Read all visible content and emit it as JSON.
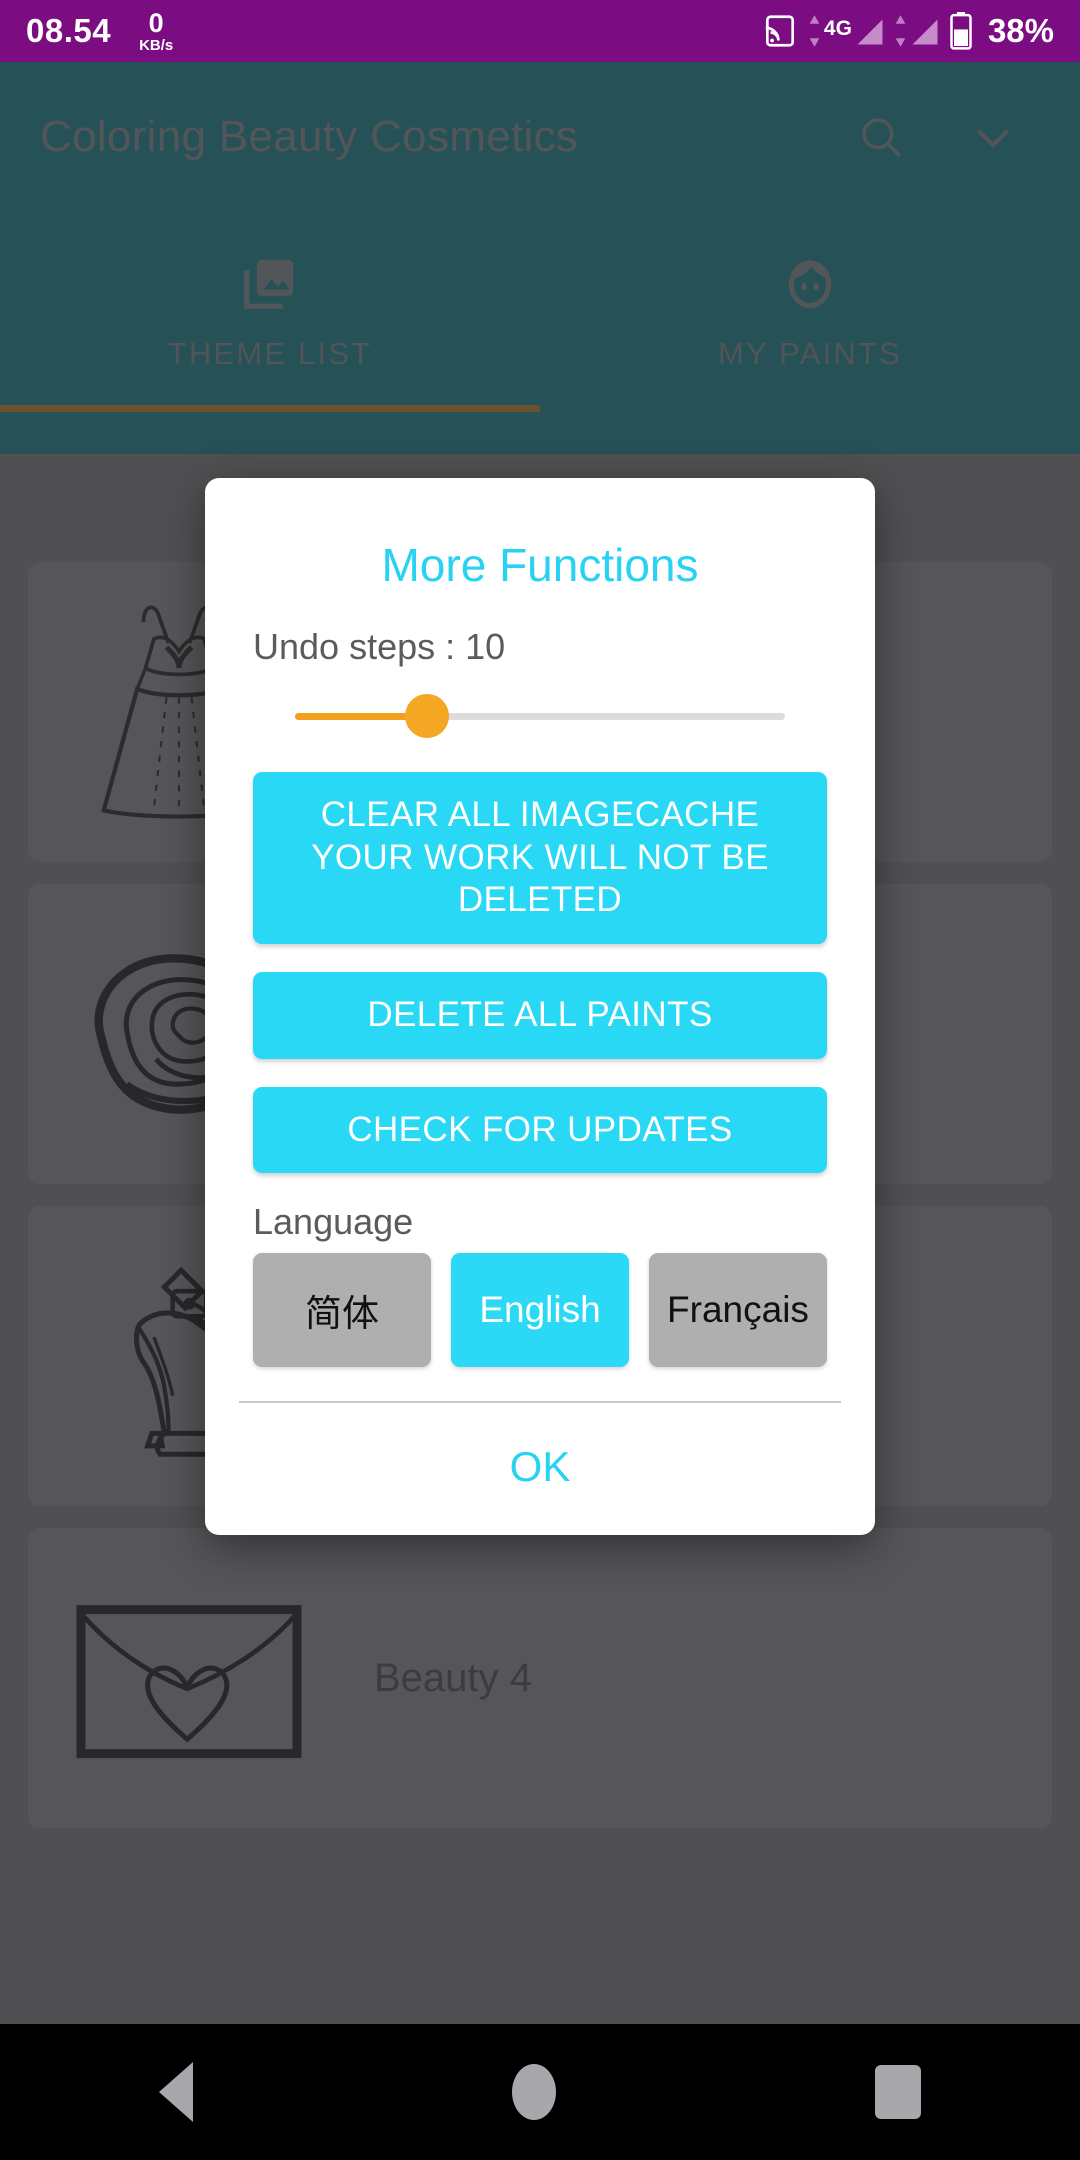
{
  "statusbar": {
    "time": "08.54",
    "net_rate": "0",
    "net_unit": "KB/s",
    "network_type": "4G",
    "battery": "38%",
    "icons": [
      "cast-icon",
      "signal-4g-icon",
      "signal-bars-icon",
      "battery-icon"
    ]
  },
  "appbar": {
    "title": "Coloring Beauty Cosmetics",
    "search_icon": "search-icon",
    "overflow_icon": "chevron-down-icon"
  },
  "tabs": [
    {
      "label": "THEME LIST",
      "icon": "photo-library-icon",
      "active": true
    },
    {
      "label": "MY PAINTS",
      "icon": "face-icon",
      "active": false
    }
  ],
  "background_list": [
    {
      "label": "",
      "thumb": "dress-icon"
    },
    {
      "label": "",
      "thumb": "rose-icon"
    },
    {
      "label": "",
      "thumb": "high-heel-icon"
    },
    {
      "label": "Beauty 4",
      "thumb": "envelope-heart-icon"
    }
  ],
  "dialog": {
    "title": "More Functions",
    "undo_label": "Undo steps : 10",
    "undo_value": 10,
    "slider_percent": 27,
    "buttons": [
      "CLEAR ALL IMAGECACHE YOUR WORK WILL NOT BE DELETED",
      "DELETE ALL PAINTS",
      "CHECK FOR UPDATES"
    ],
    "language_title": "Language",
    "languages": [
      {
        "label": "简体",
        "selected": false
      },
      {
        "label": "English",
        "selected": true
      },
      {
        "label": "Français",
        "selected": false
      }
    ],
    "ok_label": "OK"
  },
  "navbar": {
    "back": "back-icon",
    "home": "home-icon",
    "recents": "recents-icon"
  },
  "colors": {
    "status_bar": "#7B0C82",
    "app_bar": "#0A6B74",
    "accent_cyan": "#29D8F5",
    "slider_orange": "#F5A623",
    "tab_indicator": "#A36A17"
  }
}
